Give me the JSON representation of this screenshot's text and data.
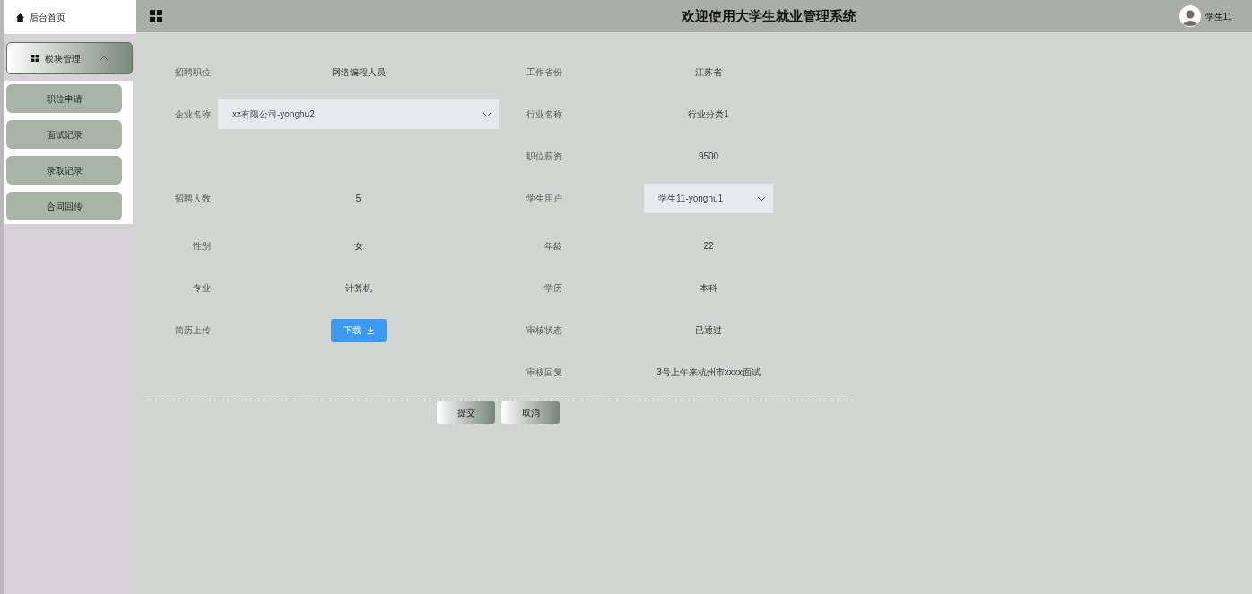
{
  "header": {
    "home_tab": "后台首页",
    "title": "欢迎使用大学生就业管理系统",
    "user": "学生11"
  },
  "sidebar": {
    "menu": {
      "label": "模块管理",
      "expanded": true,
      "items": [
        {
          "label": "职位申请"
        },
        {
          "label": "面试记录"
        },
        {
          "label": "录取记录"
        },
        {
          "label": "合同回传"
        }
      ]
    }
  },
  "form": {
    "rows": [
      {
        "left": {
          "kind": "text",
          "label": "招聘职位",
          "value": "网络编程人员"
        },
        "right": {
          "kind": "text",
          "label": "工作省份",
          "value": "江苏省"
        }
      },
      {
        "left": {
          "kind": "select",
          "label": "企业名称",
          "value": "xx有限公司-yonghu2"
        },
        "right": {
          "kind": "text",
          "label": "行业名称",
          "value": "行业分类1"
        }
      },
      {
        "right": {
          "kind": "text",
          "label": "职位薪资",
          "value": "9500"
        }
      },
      {
        "left": {
          "kind": "text",
          "label": "招聘人数",
          "value": "5"
        },
        "right": {
          "kind": "select",
          "label": "学生用户",
          "value": "学生11-yonghu1"
        }
      },
      {
        "left": {
          "kind": "text",
          "label": "性别",
          "value": "女"
        },
        "right": {
          "kind": "text",
          "label": "年龄",
          "value": "22"
        }
      },
      {
        "left": {
          "kind": "text",
          "label": "专业",
          "value": "计算机"
        },
        "right": {
          "kind": "text",
          "label": "学历",
          "value": "本科"
        }
      },
      {
        "left": {
          "kind": "button",
          "label": "简历上传",
          "value": "下载"
        },
        "right": {
          "kind": "text",
          "label": "审核状态",
          "value": "已通过"
        }
      },
      {
        "right": {
          "kind": "text",
          "label": "审核回复",
          "value": "3号上午来杭州市xxxx面试"
        }
      }
    ],
    "buttons": [
      {
        "label": "提交"
      },
      {
        "label": "取消"
      }
    ]
  }
}
